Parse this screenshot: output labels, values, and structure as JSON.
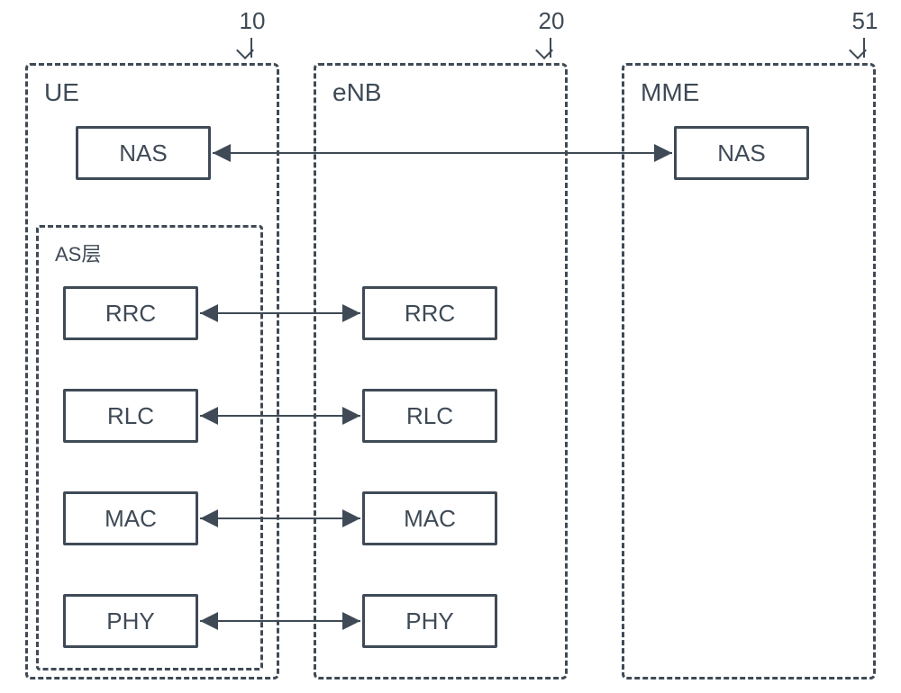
{
  "topLabels": {
    "ue": "10",
    "enb": "20",
    "mme": "51"
  },
  "columns": {
    "ue": "UE",
    "enb": "eNB",
    "mme": "MME"
  },
  "asLayer": {
    "label": "AS层"
  },
  "protocols": {
    "nas": "NAS",
    "rrc": "RRC",
    "rlc": "RLC",
    "mac": "MAC",
    "phy": "PHY"
  }
}
